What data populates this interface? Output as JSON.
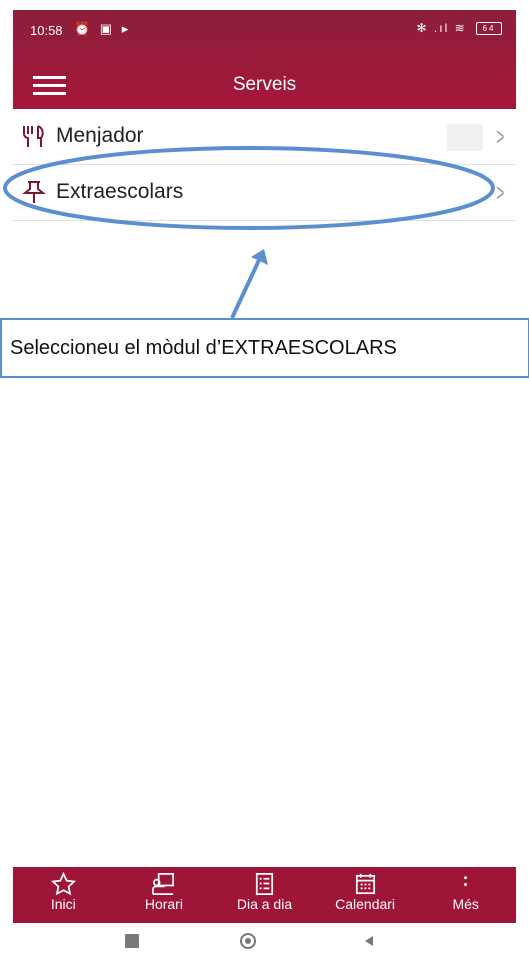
{
  "status_bar": {
    "time": "10:58",
    "left_icons": "⏰ ▣ ▸",
    "right_icons": "✻ .ıl ≋",
    "battery": "64"
  },
  "header": {
    "title": "Serveis"
  },
  "list_items": [
    {
      "label": "Menjador",
      "icon": "fork-knife-icon"
    },
    {
      "label": "Extraescolars",
      "icon": "pin-icon"
    }
  ],
  "callout": {
    "text": "Seleccioneu el mòdul d’EXTRAESCOLARS"
  },
  "bottom_nav": [
    {
      "label": "Inici",
      "icon": "star-icon"
    },
    {
      "label": "Horari",
      "icon": "teacher-board-icon"
    },
    {
      "label": "Dia a dia",
      "icon": "checklist-icon"
    },
    {
      "label": "Calendari",
      "icon": "calendar-icon"
    },
    {
      "label": "Més",
      "icon": "more-vertical-icon"
    }
  ],
  "colors": {
    "brand": "#9f1538",
    "highlight": "#5b8fd0"
  }
}
